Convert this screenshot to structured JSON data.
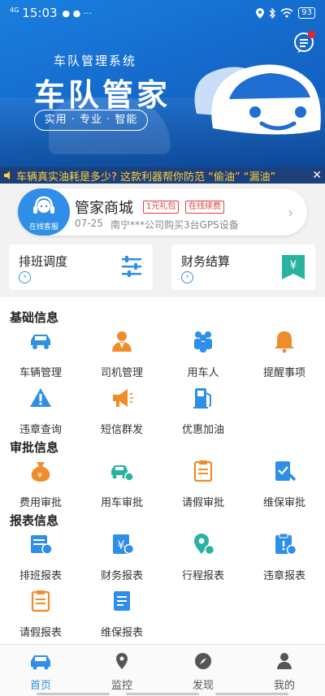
{
  "status_bar": {
    "network": "4G",
    "signal": "iil",
    "time": "15:03",
    "battery": "93"
  },
  "banner": {
    "system_name": "车队管理系统",
    "brand": "车队管家",
    "slogan": "实用 · 专业 · 智能"
  },
  "ticker": {
    "text": "车辆真实油耗是多少? 这款利器帮你防范 “偷油” “漏油”"
  },
  "mall": {
    "service_label": "在线客服",
    "title": "管家商城",
    "tag1": "1元礼包",
    "tag2": "在线续费",
    "date": "07-25",
    "info": "南宁***公司购买3台GPS设备"
  },
  "quick": {
    "schedule": "排班调度",
    "finance": "财务结算"
  },
  "sections": {
    "basic": {
      "title": "基础信息",
      "items": [
        "车辆管理",
        "司机管理",
        "用车人",
        "提醒事项",
        "违章查询",
        "短信群发",
        "优惠加油"
      ]
    },
    "approval": {
      "title": "审批信息",
      "items": [
        "费用审批",
        "用车审批",
        "请假审批",
        "维保审批"
      ]
    },
    "reports": {
      "title": "报表信息",
      "items": [
        "排班报表",
        "财务报表",
        "行程报表",
        "违章报表",
        "请假报表",
        "维保报表"
      ]
    }
  },
  "tabs": [
    "首页",
    "监控",
    "发现",
    "我的"
  ],
  "colors": {
    "primary": "#2f8fe8",
    "orange": "#f08c2a",
    "teal": "#27b3a0",
    "tag_red": "#e0433b"
  }
}
